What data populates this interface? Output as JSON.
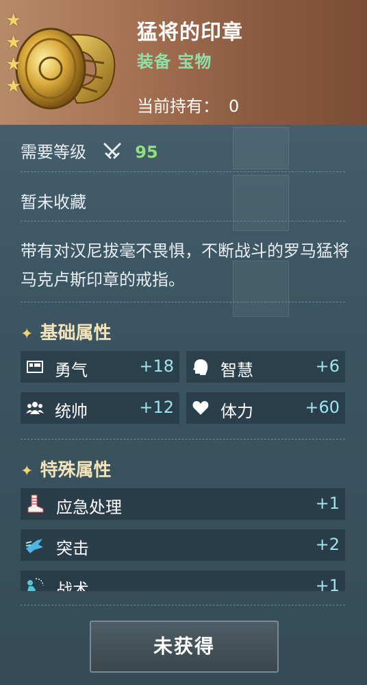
{
  "item": {
    "name": "猛将的印章",
    "tags": "装备 宝物",
    "holding_label": "当前持有：",
    "holding_count": "0",
    "star_count": 4
  },
  "requirement": {
    "label": "需要等级",
    "icon": "crossed-swords-icon",
    "level": "95"
  },
  "collect_status": "暂未收藏",
  "description": "带有对汉尼拔毫不畏惧，不断战斗的罗马猛将马克卢斯印章的戒指。",
  "base_stats": {
    "title": "基础属性",
    "items": [
      {
        "icon": "courage-icon",
        "label": "勇气",
        "value": "+18"
      },
      {
        "icon": "wisdom-head-icon",
        "label": "智慧",
        "value": "+6"
      },
      {
        "icon": "leadership-group-icon",
        "label": "统帅",
        "value": "+12"
      },
      {
        "icon": "heart-icon",
        "label": "体力",
        "value": "+60"
      }
    ]
  },
  "special_stats": {
    "title": "特殊属性",
    "items": [
      {
        "icon": "bandaged-foot-icon",
        "label": "应急处理",
        "value": "+1"
      },
      {
        "icon": "charge-icon",
        "label": "突击",
        "value": "+2"
      },
      {
        "icon": "tactics-icon",
        "label": "战术",
        "value": "+1"
      }
    ]
  },
  "action_button": "未获得",
  "colors": {
    "accent_green": "#8fe0a8",
    "level_green": "#8fe07a",
    "stat_value": "#9ee4ef",
    "star": "#f3d36b"
  }
}
